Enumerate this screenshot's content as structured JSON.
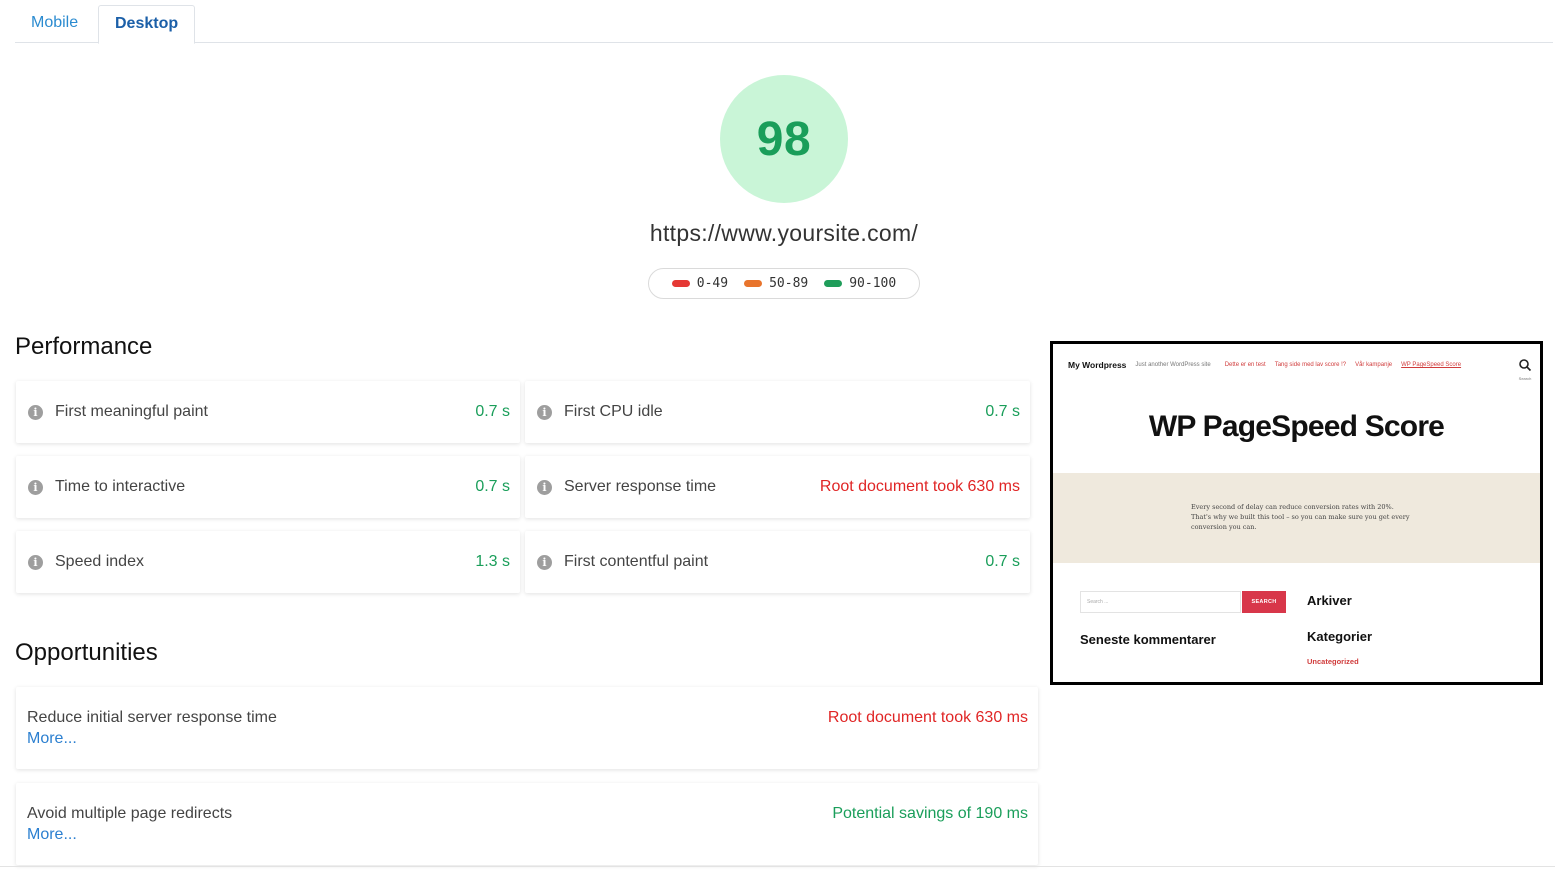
{
  "tabs": [
    {
      "label": "Mobile"
    },
    {
      "label": "Desktop"
    }
  ],
  "score": {
    "value": "98",
    "color": "#1a9e5a",
    "background": "#c9f5d7",
    "url": "https://www.yoursite.com/"
  },
  "legend": [
    {
      "range": "0-49",
      "color": "#e53935"
    },
    {
      "range": "50-89",
      "color": "#e8742c"
    },
    {
      "range": "90-100",
      "color": "#1f9d5a"
    }
  ],
  "performance": {
    "title": "Performance",
    "metrics": [
      {
        "label": "First meaningful paint",
        "value": "0.7 s",
        "status": "good"
      },
      {
        "label": "First CPU idle",
        "value": "0.7 s",
        "status": "good"
      },
      {
        "label": "Time to interactive",
        "value": "0.7 s",
        "status": "good"
      },
      {
        "label": "Server response time",
        "value": "Root document took 630 ms",
        "status": "bad"
      },
      {
        "label": "Speed index",
        "value": "1.3 s",
        "status": "good"
      },
      {
        "label": "First contentful paint",
        "value": "0.7 s",
        "status": "good"
      }
    ]
  },
  "opportunities": {
    "title": "Opportunities",
    "items": [
      {
        "label": "Reduce initial server response time",
        "more": "More...",
        "value": "Root document took 630 ms",
        "status": "bad"
      },
      {
        "label": "Avoid multiple page redirects",
        "more": "More...",
        "value": "Potential savings of 190 ms",
        "status": "good"
      }
    ]
  },
  "screenshot": {
    "brand": "My Wordpress",
    "tagline": "Just another WordPress site",
    "nav_links": [
      "Dette er en test",
      "Tang side med lav score !?",
      "Vår kampanje",
      "WP PageSpeed Score"
    ],
    "search_label": "Search",
    "title": "WP PageSpeed Score",
    "band_text": "Every second of delay can reduce conversion rates with 20%. That's why we built this tool – so you can make sure you get every conversion you can.",
    "search_placeholder": "Search ...",
    "search_button": "SEARCH",
    "archives": "Arkiver",
    "recent_comments": "Seneste kommentarer",
    "categories": "Kategorier",
    "category_item": "Uncategorized"
  }
}
